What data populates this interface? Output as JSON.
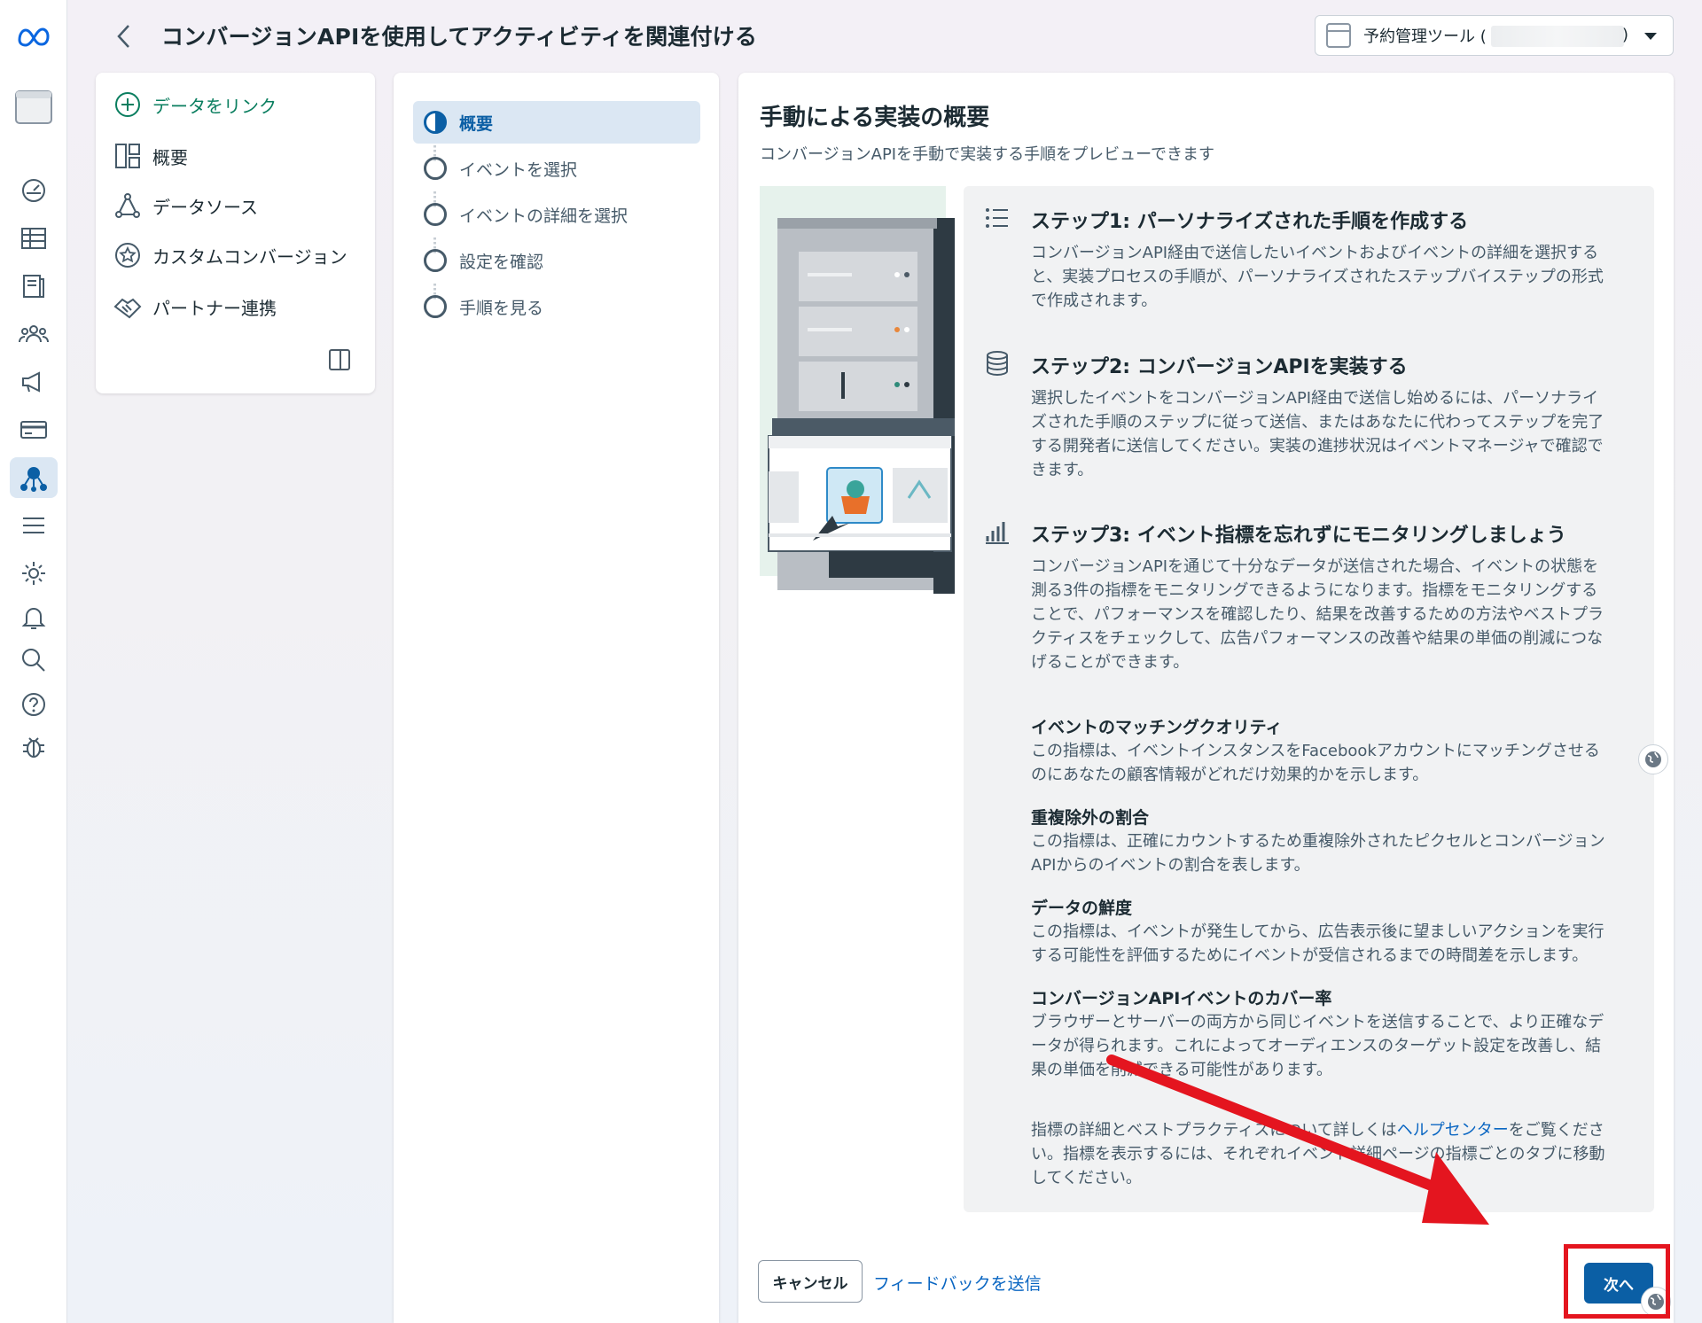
{
  "header": {
    "title": "コンバージョンAPIを使用してアクティビティを関連付ける",
    "account_label": "予約管理ツール (",
    "account_paren": ")"
  },
  "rail": {
    "items": [
      "meta-logo",
      "app-window-icon",
      "dashboard-icon",
      "table-icon",
      "pages-icon",
      "audience-icon",
      "megaphone-icon",
      "billing-icon",
      "events-manager-icon",
      "menu-icon",
      "settings-icon",
      "bell-icon",
      "search-icon",
      "help-icon",
      "bug-icon"
    ],
    "active": "events-manager-icon",
    "accent": "#0b5fa5"
  },
  "nav": {
    "link_data": "データをリンク",
    "overview": "概要",
    "data_sources": "データソース",
    "custom_conversions": "カスタムコンバージョン",
    "partner": "パートナー連携"
  },
  "steps": [
    {
      "label": "概要",
      "active": true
    },
    {
      "label": "イベントを選択",
      "active": false
    },
    {
      "label": "イベントの詳細を選択",
      "active": false
    },
    {
      "label": "設定を確認",
      "active": false
    },
    {
      "label": "手順を見る",
      "active": false
    }
  ],
  "main": {
    "title": "手動による実装の概要",
    "subtitle": "コンバージョンAPIを手動で実装する手順をプレビューできます",
    "step1": {
      "title": "ステップ1: パーソナライズされた手順を作成する",
      "lines": [
        "コンバージョンAPI経由で送信したいイベントおよびイベントの詳細を選択する",
        "と、実装プロセスの手順が、パーソナライズされたステップバイステップの形式",
        "で作成されます。"
      ]
    },
    "step2": {
      "title": "ステップ2: コンバージョンAPIを実装する",
      "lines": [
        "選択したイベントをコンバージョンAPI経由で送信し始めるには、パーソナライ",
        "ズされた手順のステップに従って送信、またはあなたに代わってステップを完了",
        "する開発者に送信してください。実装の進捗状況はイベントマネージャで確認で",
        "きます。"
      ]
    },
    "step3": {
      "title": "ステップ3: イベント指標を忘れずにモニタリングしましょう",
      "lines": [
        "コンバージョンAPIを通じて十分なデータが送信された場合、イベントの状態を",
        "測る3件の指標をモニタリングできるようになります。指標をモニタリングする",
        "ことで、パフォーマンスを確認したり、結果を改善するための方法やベストプラ",
        "クティスをチェックして、広告パフォーマンスの改善や結果の単価の削減につな",
        "げることができます。"
      ]
    },
    "metrics": [
      {
        "title": "イベントのマッチングクオリティ",
        "lines": [
          "この指標は、イベントインスタンスをFacebookアカウントにマッチングさせる",
          "のにあなたの顧客情報がどれだけ効果的かを示します。"
        ]
      },
      {
        "title": "重複除外の割合",
        "lines": [
          "この指標は、正確にカウントするため重複除外されたピクセルとコンバージョン",
          "APIからのイベントの割合を表します。"
        ]
      },
      {
        "title": "データの鮮度",
        "lines": [
          "この指標は、イベントが発生してから、広告表示後に望ましいアクションを実行",
          "する可能性を評価するためにイベントが受信されるまでの時間差を示します。"
        ]
      },
      {
        "title": "コンバージョンAPIイベントのカバー率",
        "lines": [
          "ブラウザーとサーバーの両方から同じイベントを送信することで、より正確なデ",
          "ータが得られます。これによってオーディエンスのターゲット設定を改善し、結",
          "果の単価を削減できる可能性があります。"
        ]
      }
    ],
    "footer_note": {
      "before": "指標の詳細とベストプラクティスについて詳しくは",
      "link": "ヘルプセンター",
      "after": "をご覧くださ",
      "lines": [
        "い。指標を表示するには、それぞれイベント詳細ページの指標ごとのタブに移動",
        "してください。"
      ]
    },
    "cancel": "キャンセル",
    "feedback": "フィードバックを送信",
    "next": "次へ"
  },
  "annotation": {
    "color": "#e4151f"
  }
}
